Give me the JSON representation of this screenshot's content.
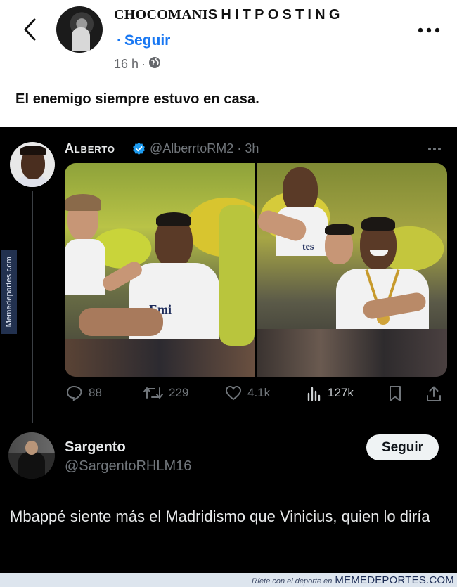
{
  "fb_post": {
    "page_name_part1": "CHOCOMANI",
    "page_name_part2": "SHITPOSTING",
    "follow_dot": "·",
    "follow_label": "Seguir",
    "time": "16 h",
    "separator": "·",
    "privacy_icon": "globe-icon",
    "caption": "El enemigo siempre estuvo en casa."
  },
  "side_watermark": "Memedeportes.com",
  "tweet": {
    "author_name": "Alberto",
    "author_handle": "@AlberrtoRM2",
    "time_sep": "·",
    "time": "3h",
    "verified_color": "#1d9bf0",
    "photo_left_shirt_text": "Emi",
    "photo_right_shirt_text": "tes",
    "actions": {
      "replies": "88",
      "retweets": "229",
      "likes": "4.1k",
      "views": "127k"
    }
  },
  "reply_card": {
    "name": "Sargento",
    "handle": "@SargentoRHLM16",
    "follow_label": "Seguir",
    "text": "Mbappé siente más el Madridismo que Vinicius, quien lo diría"
  },
  "footer": {
    "small_text": "Ríete con el deporte en",
    "brand": "MEMEDEPORTES.COM"
  },
  "colors": {
    "fb_blue": "#1877f2",
    "dark_bg": "#000000",
    "muted": "#71767b"
  }
}
